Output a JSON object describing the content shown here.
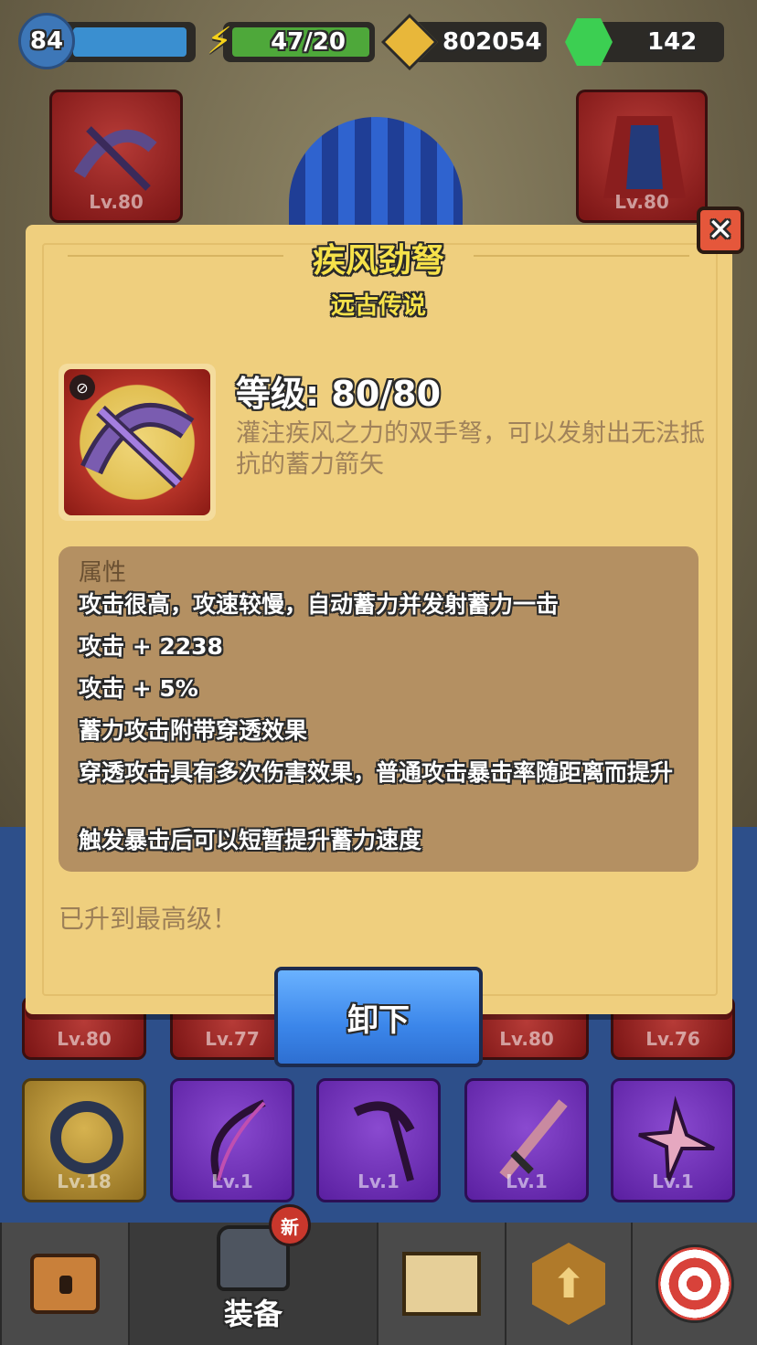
{
  "top_bar": {
    "player_level": "84",
    "energy": "47/20",
    "gold": "802054",
    "gems": "142"
  },
  "hero_slots": [
    {
      "level": "Lv.80",
      "type": "crossbow-icon"
    },
    {
      "level": "Lv.80",
      "type": "armor-icon"
    }
  ],
  "bag_slots_row1": [
    "Lv.80",
    "Lv.77",
    "Lv.80",
    "Lv.76"
  ],
  "bag_slots_row2": [
    {
      "level": "Lv.18",
      "type": "helmet-ring-icon",
      "rarity": "gold"
    },
    {
      "level": "Lv.1",
      "type": "bow-icon",
      "rarity": "purple"
    },
    {
      "level": "Lv.1",
      "type": "scythe-icon",
      "rarity": "purple"
    },
    {
      "level": "Lv.1",
      "type": "sword-icon",
      "rarity": "purple"
    },
    {
      "level": "Lv.1",
      "type": "shuriken-icon",
      "rarity": "purple"
    }
  ],
  "modal": {
    "title": "疾风劲弩",
    "quality": "远古传说",
    "level": "等级: 80/80",
    "description": "灌注疾风之力的双手弩，可以发射出无法抵抗的蓄力箭矢",
    "attributes_header": "属性",
    "attributes": [
      "攻击很高，攻速较慢，自动蓄力并发射蓄力一击",
      "攻击 + 2238",
      "攻击 + 5%",
      "蓄力攻击附带穿透效果",
      "穿透攻击具有多次伤害效果，普通攻击暴击率随距离而提升",
      "触发暴击后可以短暂提升蓄力速度"
    ],
    "max_level_text": "已升到最高级！",
    "unequip_label": "卸下"
  },
  "bottom_nav": {
    "equip_label": "装备",
    "new_badge": "新",
    "tabs": [
      "chest-icon",
      "armor-icon",
      "map-icon",
      "upgrade-arrow-icon",
      "target-icon"
    ]
  },
  "colors": {
    "modal_bg": "#efcf7e",
    "title_yellow": "#f6e24a",
    "attr_box": "#b49062",
    "unequip_blue": "#3b86ea",
    "close_red": "#e5573b"
  }
}
